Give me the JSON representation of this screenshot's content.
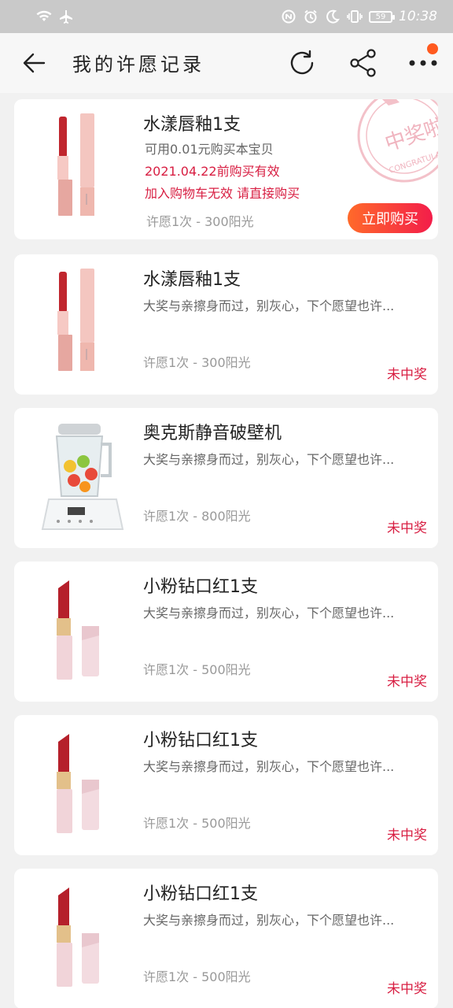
{
  "status_bar": {
    "time": "10:38",
    "battery": "59"
  },
  "nav": {
    "title": "我的许愿记录"
  },
  "stamp": {
    "text": "中奖啦",
    "subtext": "CONGRATULATIONS"
  },
  "cards": [
    {
      "title": "水漾唇釉1支",
      "line2": "可用0.01元购买本宝贝",
      "line3": "2021.04.22前购买有效",
      "line4": "加入购物车无效 请直接购买",
      "meta": "许愿1次 - 300阳光",
      "action": "立即购买"
    },
    {
      "title": "水漾唇釉1支",
      "desc": "大奖与亲擦身而过，别灰心，下个愿望也许...",
      "meta": "许愿1次 - 300阳光",
      "status": "未中奖"
    },
    {
      "title": "奥克斯静音破壁机",
      "desc": "大奖与亲擦身而过，别灰心，下个愿望也许...",
      "meta": "许愿1次 - 800阳光",
      "status": "未中奖"
    },
    {
      "title": "小粉钻口红1支",
      "desc": "大奖与亲擦身而过，别灰心，下个愿望也许...",
      "meta": "许愿1次 - 500阳光",
      "status": "未中奖"
    },
    {
      "title": "小粉钻口红1支",
      "desc": "大奖与亲擦身而过，别灰心，下个愿望也许...",
      "meta": "许愿1次 - 500阳光",
      "status": "未中奖"
    },
    {
      "title": "小粉钻口红1支",
      "desc": "大奖与亲擦身而过，别灰心，下个愿望也许...",
      "meta": "许愿1次 - 500阳光",
      "status": "未中奖"
    }
  ],
  "colors": {
    "accent_red": "#d81e42",
    "button_start": "#ff6a2a",
    "button_end": "#f31d4a"
  }
}
